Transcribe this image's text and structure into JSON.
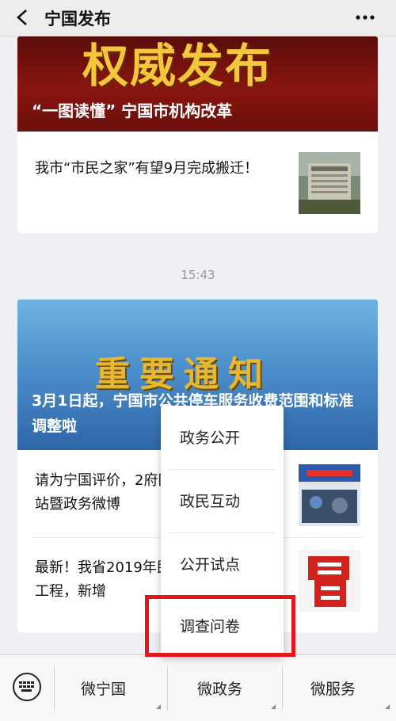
{
  "header": {
    "title": "宁国发布"
  },
  "card1": {
    "banner_big": "权威发布",
    "banner_caption": "“一图读懂” 宁国市机构改革",
    "article_text": "我市“市民之家”有望9月完成搬迁！"
  },
  "time": "15:43",
  "card2": {
    "banner_big": "重要通知",
    "banner_caption": "3月1日起，宁国市公共停车服务收费范围和标准调整啦",
    "article1": "请为宁国评价，2府网站暨政务微博",
    "article2": "最新！我省2019年民生工程，新增"
  },
  "popup_menu": {
    "items": [
      "政务公开",
      "政民互动",
      "公开试点",
      "调查问卷"
    ]
  },
  "bottom_tabs": [
    "微宁国",
    "微政务",
    "微服务"
  ],
  "colors": {
    "highlight": "#e5151c",
    "banner1": "#8a1610",
    "banner2": "#4d8fcc",
    "gold": "#f3c73b"
  }
}
